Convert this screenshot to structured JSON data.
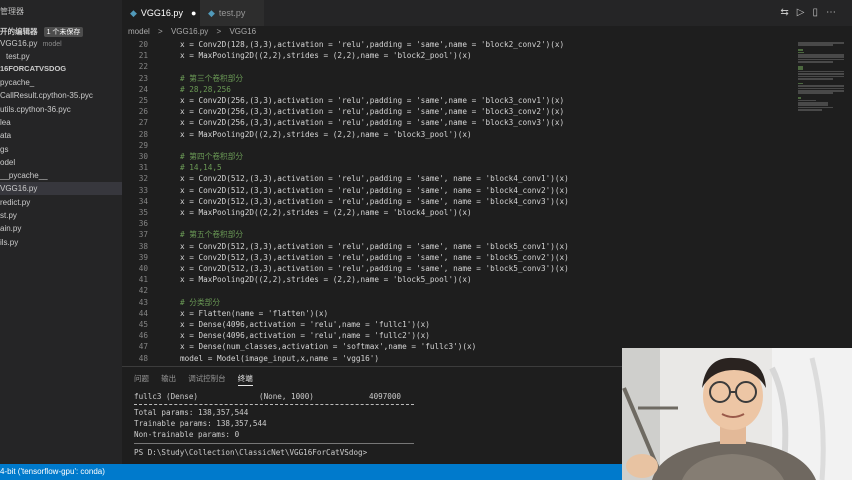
{
  "sidebar": {
    "title": "管理器",
    "open_editors": "开的编辑器",
    "unsaved_badge": "1 个未保存",
    "open_items": [
      {
        "label": "VGG16.py",
        "hint": "model"
      },
      {
        "label": "test.py",
        "hint": ""
      }
    ],
    "project": "16FORCATVSDOG",
    "items": [
      "pycache_",
      "CallResult.cpython-35.pyc",
      "utils.cpython-36.pyc",
      "lea",
      "ata",
      "gs",
      "odel",
      "__pycache__",
      "VGG16.py",
      "redict.py",
      "st.py",
      "ain.py",
      "ils.py"
    ]
  },
  "tabs": [
    {
      "label": "VGG16.py",
      "modified": "●"
    },
    {
      "label": "test.py",
      "modified": ""
    }
  ],
  "breadcrumb": [
    "model",
    ">",
    "VGG16.py",
    ">",
    "VGG16"
  ],
  "editor": {
    "lines": [
      {
        "n": "20",
        "text": "x = Conv2D(128,(3,3),activation = 'relu',padding = 'same',name = 'block2_conv2')(x)",
        "comment": false
      },
      {
        "n": "21",
        "text": "x = MaxPooling2D((2,2),strides = (2,2),name = 'block2_pool')(x)",
        "comment": false
      },
      {
        "n": "22",
        "text": "",
        "comment": false
      },
      {
        "n": "23",
        "text": "# 第三个卷积部分",
        "comment": true
      },
      {
        "n": "24",
        "text": "# 28,28,256",
        "comment": true
      },
      {
        "n": "25",
        "text": "x = Conv2D(256,(3,3),activation = 'relu',padding = 'same',name = 'block3_conv1')(x)",
        "comment": false
      },
      {
        "n": "26",
        "text": "x = Conv2D(256,(3,3),activation = 'relu',padding = 'same',name = 'block3_conv2')(x)",
        "comment": false
      },
      {
        "n": "27",
        "text": "x = Conv2D(256,(3,3),activation = 'relu',padding = 'same',name = 'block3_conv3')(x)",
        "comment": false
      },
      {
        "n": "28",
        "text": "x = MaxPooling2D((2,2),strides = (2,2),name = 'block3_pool')(x)",
        "comment": false
      },
      {
        "n": "29",
        "text": "",
        "comment": false
      },
      {
        "n": "30",
        "text": "# 第四个卷积部分",
        "comment": true
      },
      {
        "n": "31",
        "text": "# 14,14,5",
        "comment": true
      },
      {
        "n": "32",
        "text": "x = Conv2D(512,(3,3),activation = 'relu',padding = 'same', name = 'block4_conv1')(x)",
        "comment": false
      },
      {
        "n": "33",
        "text": "x = Conv2D(512,(3,3),activation = 'relu',padding = 'same', name = 'block4_conv2')(x)",
        "comment": false
      },
      {
        "n": "34",
        "text": "x = Conv2D(512,(3,3),activation = 'relu',padding = 'same', name = 'block4_conv3')(x)",
        "comment": false
      },
      {
        "n": "35",
        "text": "x = MaxPooling2D((2,2),strides = (2,2),name = 'block4_pool')(x)",
        "comment": false
      },
      {
        "n": "36",
        "text": "",
        "comment": false
      },
      {
        "n": "37",
        "text": "# 第五个卷积部分",
        "comment": true
      },
      {
        "n": "38",
        "text": "x = Conv2D(512,(3,3),activation = 'relu',padding = 'same', name = 'block5_conv1')(x)",
        "comment": false
      },
      {
        "n": "39",
        "text": "x = Conv2D(512,(3,3),activation = 'relu',padding = 'same', name = 'block5_conv2')(x)",
        "comment": false
      },
      {
        "n": "40",
        "text": "x = Conv2D(512,(3,3),activation = 'relu',padding = 'same', name = 'block5_conv3')(x)",
        "comment": false
      },
      {
        "n": "41",
        "text": "x = MaxPooling2D((2,2),strides = (2,2),name = 'block5_pool')(x)",
        "comment": false
      },
      {
        "n": "42",
        "text": "",
        "comment": false
      },
      {
        "n": "43",
        "text": "# 分类部分",
        "comment": true
      },
      {
        "n": "44",
        "text": "x = Flatten(name = 'flatten')(x)",
        "comment": false
      },
      {
        "n": "45",
        "text": "x = Dense(4096,activation = 'relu',name = 'fullc1')(x)",
        "comment": false
      },
      {
        "n": "46",
        "text": "x = Dense(4096,activation = 'relu',name = 'fullc2')(x)",
        "comment": false
      },
      {
        "n": "47",
        "text": "x = Dense(num_classes,activation = 'softmax',name = 'fullc3')(x)",
        "comment": false
      },
      {
        "n": "48",
        "text": "model = Model(image_input,x,name = 'vgg16')",
        "comment": false
      }
    ]
  },
  "panel": {
    "tabs": [
      "问题",
      "输出",
      "调试控制台",
      "终端"
    ],
    "active_tab": 3,
    "summary_row": [
      "fullc3 (Dense)",
      "(None, 1000)",
      "4097000"
    ],
    "total": "Total params: 138,357,544",
    "trainable": "Trainable params: 138,357,544",
    "non_trainable": "Non-trainable params: 0",
    "prompt": "PS D:\\Study\\Collection\\ClassicNet\\VGG16ForCatVSdog>"
  },
  "status": {
    "interpreter": "4-bit ('tensorflow-gpu': conda)"
  },
  "icon_names": [
    "python-file-icon",
    "split-editor-icon",
    "run-icon",
    "more-icon"
  ],
  "colors": {
    "accent": "#007acc",
    "comment": "#6a9955",
    "python_icon": "#519aba"
  }
}
